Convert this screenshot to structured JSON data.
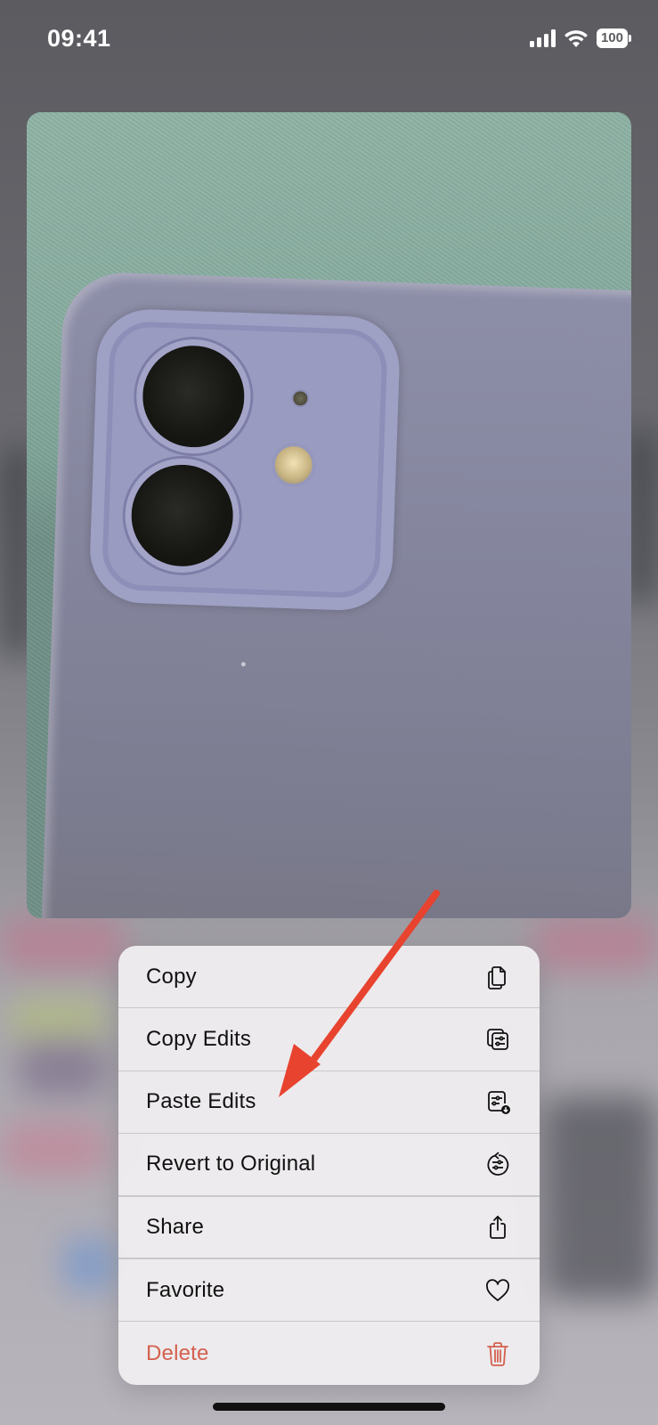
{
  "status_bar": {
    "time": "09:41",
    "battery_level": "100",
    "icons": [
      "cellular-signal-icon",
      "wifi-icon",
      "battery-icon"
    ]
  },
  "photo": {
    "subject": "purple phone case camera closeup"
  },
  "context_menu": {
    "items": [
      {
        "label": "Copy",
        "icon": "copy-icon",
        "destructive": false
      },
      {
        "label": "Copy Edits",
        "icon": "copy-edits-icon",
        "destructive": false
      },
      {
        "label": "Paste Edits",
        "icon": "paste-edits-icon",
        "destructive": false
      },
      {
        "label": "Revert to Original",
        "icon": "revert-icon",
        "destructive": false
      },
      {
        "label": "Share",
        "icon": "share-icon",
        "destructive": false
      },
      {
        "label": "Favorite",
        "icon": "heart-icon",
        "destructive": false
      },
      {
        "label": "Delete",
        "icon": "trash-icon",
        "destructive": true
      }
    ]
  },
  "annotation": {
    "type": "arrow",
    "points_to": "Paste Edits",
    "color": "#e8432f"
  },
  "colors": {
    "destructive": "#d4604f",
    "menu_background": "#eeecee",
    "separator": "#c9c7cb"
  }
}
